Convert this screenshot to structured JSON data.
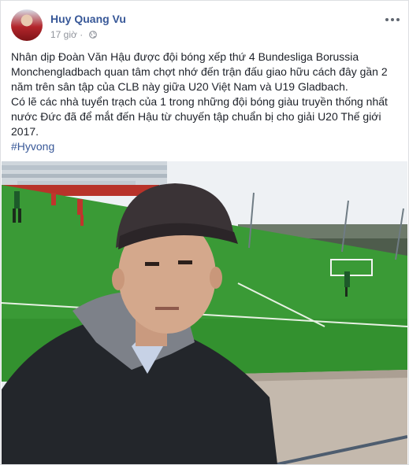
{
  "post": {
    "author": "Huy Quang Vu",
    "time": "17 giờ",
    "privacy_icon": "globe-icon",
    "more_icon": "more-dots-icon",
    "body": [
      "Nhân dịp Đoàn Văn Hậu được đội bóng xếp thứ 4 Bundesliga Borussia Monchengladbach quan tâm chợt nhớ đến trận đấu giao hữu cách đây gần 2 năm trên sân tập của CLB này giữa U20 Việt Nam và U19 Gladbach.",
      "Có lẽ các nhà tuyển trạch của 1 trong những đội bóng giàu truyền thống nhất nước Đức đã để mắt đến Hậu từ chuyến tập chuẩn bị cho giải U20 Thế giới 2017."
    ],
    "hashtag": "#Hyvong"
  },
  "colors": {
    "link": "#385898",
    "text": "#1d2129",
    "meta": "#90949c",
    "pitch": "#2f8a2e"
  }
}
